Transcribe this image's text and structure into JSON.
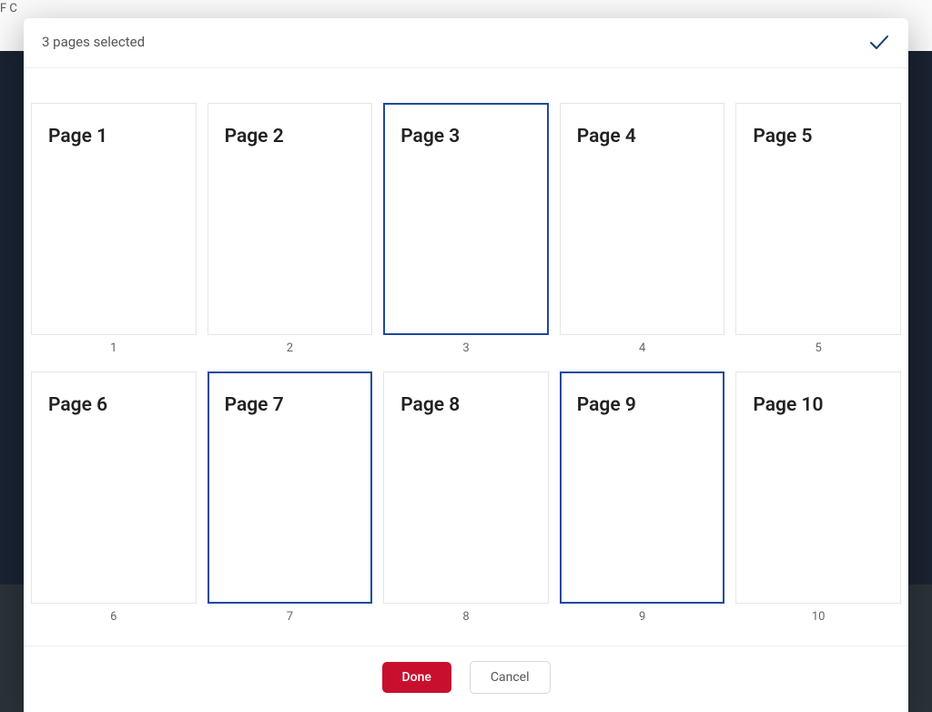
{
  "header": {
    "selection_text": "3 pages selected"
  },
  "pages": [
    {
      "label": "Page 1",
      "number": "1",
      "selected": false
    },
    {
      "label": "Page 2",
      "number": "2",
      "selected": false
    },
    {
      "label": "Page 3",
      "number": "3",
      "selected": true
    },
    {
      "label": "Page 4",
      "number": "4",
      "selected": false
    },
    {
      "label": "Page 5",
      "number": "5",
      "selected": false
    },
    {
      "label": "Page 6",
      "number": "6",
      "selected": false
    },
    {
      "label": "Page 7",
      "number": "7",
      "selected": true
    },
    {
      "label": "Page 8",
      "number": "8",
      "selected": false
    },
    {
      "label": "Page 9",
      "number": "9",
      "selected": true
    },
    {
      "label": "Page 10",
      "number": "10",
      "selected": false
    }
  ],
  "footer": {
    "done_label": "Done",
    "cancel_label": "Cancel"
  },
  "background": {
    "top_text": "F C"
  }
}
